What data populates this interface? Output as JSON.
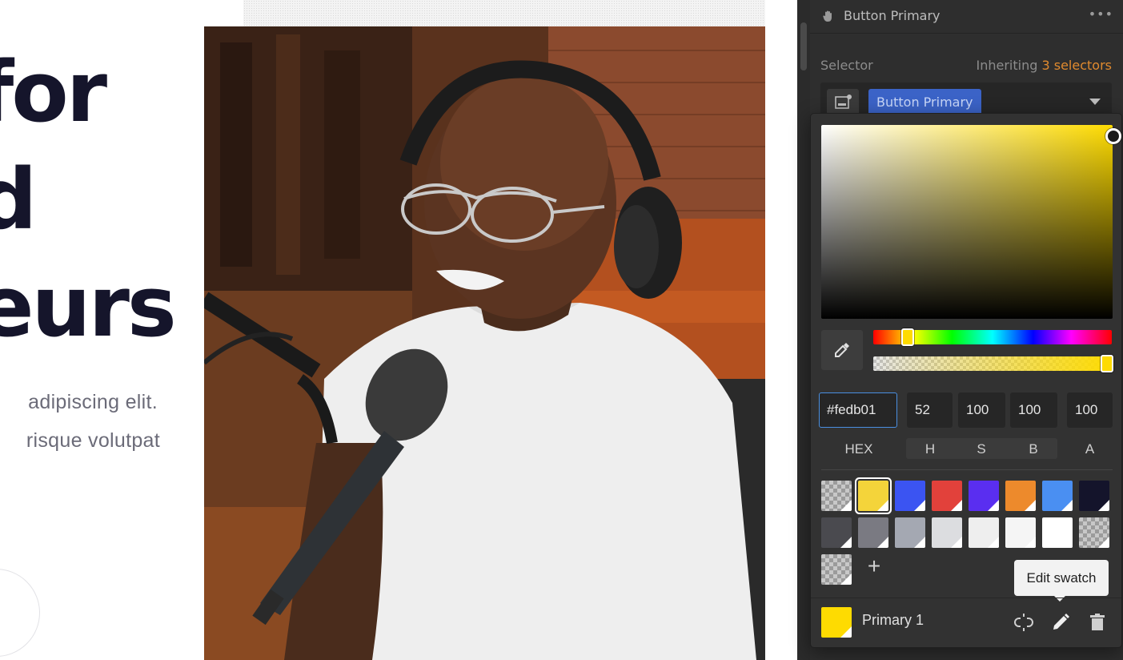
{
  "hero": {
    "heading_lines": [
      "for",
      "d",
      "eurs"
    ],
    "body_lines": [
      "adipiscing elit.",
      "risque volutpat"
    ]
  },
  "panel": {
    "element_name": "Button Primary",
    "more_label": "•••",
    "selector_label": "Selector",
    "inheriting_prefix": "Inheriting",
    "inheriting_count": "3 selectors",
    "selector_chip": "Button Primary"
  },
  "color_picker": {
    "hex_value": "#fedb01",
    "h_value": "52",
    "s_value": "100",
    "b_value": "100",
    "a_value": "100",
    "labels": {
      "hex": "HEX",
      "h": "H",
      "s": "S",
      "b": "B",
      "a": "A"
    },
    "hue_position": 0.144,
    "alpha_position": 1.0,
    "swatches": [
      {
        "color": "checker"
      },
      {
        "color": "#f4d43a",
        "selected": true
      },
      {
        "color": "#3b54f2"
      },
      {
        "color": "#e2413b"
      },
      {
        "color": "#5a2ef0"
      },
      {
        "color": "#ed8a2c"
      },
      {
        "color": "#4a8ff2"
      },
      {
        "color": "#14142b"
      },
      {
        "color": "#4a4a4f"
      },
      {
        "color": "#7a7a82"
      },
      {
        "color": "#a4a8b2"
      },
      {
        "color": "#dcdde0"
      },
      {
        "color": "#eeeeee"
      },
      {
        "color": "#f5f5f5"
      },
      {
        "color": "#ffffff"
      },
      {
        "color": "checker"
      },
      {
        "color": "checker"
      }
    ],
    "add_label": "+",
    "tooltip": "Edit swatch",
    "active_swatch_name": "Primary 1",
    "active_swatch_color": "#fedb01"
  },
  "colors": {
    "accent_orange": "#e08a2e",
    "selector_blue": "#3b63c7",
    "focus_blue": "#4a8fe0",
    "heading_navy": "#15152b"
  }
}
